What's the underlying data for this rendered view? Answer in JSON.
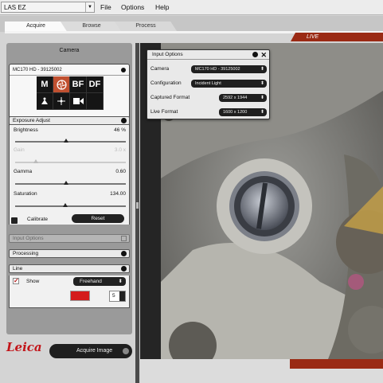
{
  "menubar": {
    "app_select": "LAS EZ",
    "menus": [
      "File",
      "Options",
      "Help"
    ]
  },
  "tabs": [
    "Acquire",
    "Browse",
    "Process"
  ],
  "live_label": "LIVE",
  "camera_panel": {
    "title": "Camera",
    "camera_name": "MC170 HD - 39125002",
    "modes": [
      "M",
      "BF",
      "DF"
    ]
  },
  "exposure": {
    "title": "Exposure Adjust",
    "brightness": {
      "label": "Brightness",
      "value": "46 %",
      "level": 0.46
    },
    "gain": {
      "label": "Gain",
      "value": "3.0 x",
      "level": 0.19
    },
    "gamma": {
      "label": "Gamma",
      "value": "0.60",
      "level": 0.46
    },
    "saturation": {
      "label": "Saturation",
      "value": "134.00",
      "level": 0.45
    },
    "calibrate_label": "Calibrate",
    "reset_label": "Reset"
  },
  "sections": {
    "input_options": "Input Options",
    "processing": "Processing",
    "line": "Line"
  },
  "line": {
    "show_label": "Show",
    "style_value": "Freehand",
    "width_value": "5",
    "color": "#d41c1c"
  },
  "bottom": {
    "logo_text": "Leica",
    "acquire_label": "Acquire Image"
  },
  "input_options": {
    "title": "Input Options",
    "rows": [
      {
        "label": "Camera",
        "value": "MC170 HD - 39125002"
      },
      {
        "label": "Configuration",
        "value": "Incident Light"
      },
      {
        "label": "Captured Format",
        "value": "2592 x 1944"
      },
      {
        "label": "Live Format",
        "value": "1600 x 1200"
      }
    ]
  },
  "colors": {
    "accent": "#9a2a14",
    "selected_mode": "#c05030",
    "logo": "#c2151a"
  }
}
